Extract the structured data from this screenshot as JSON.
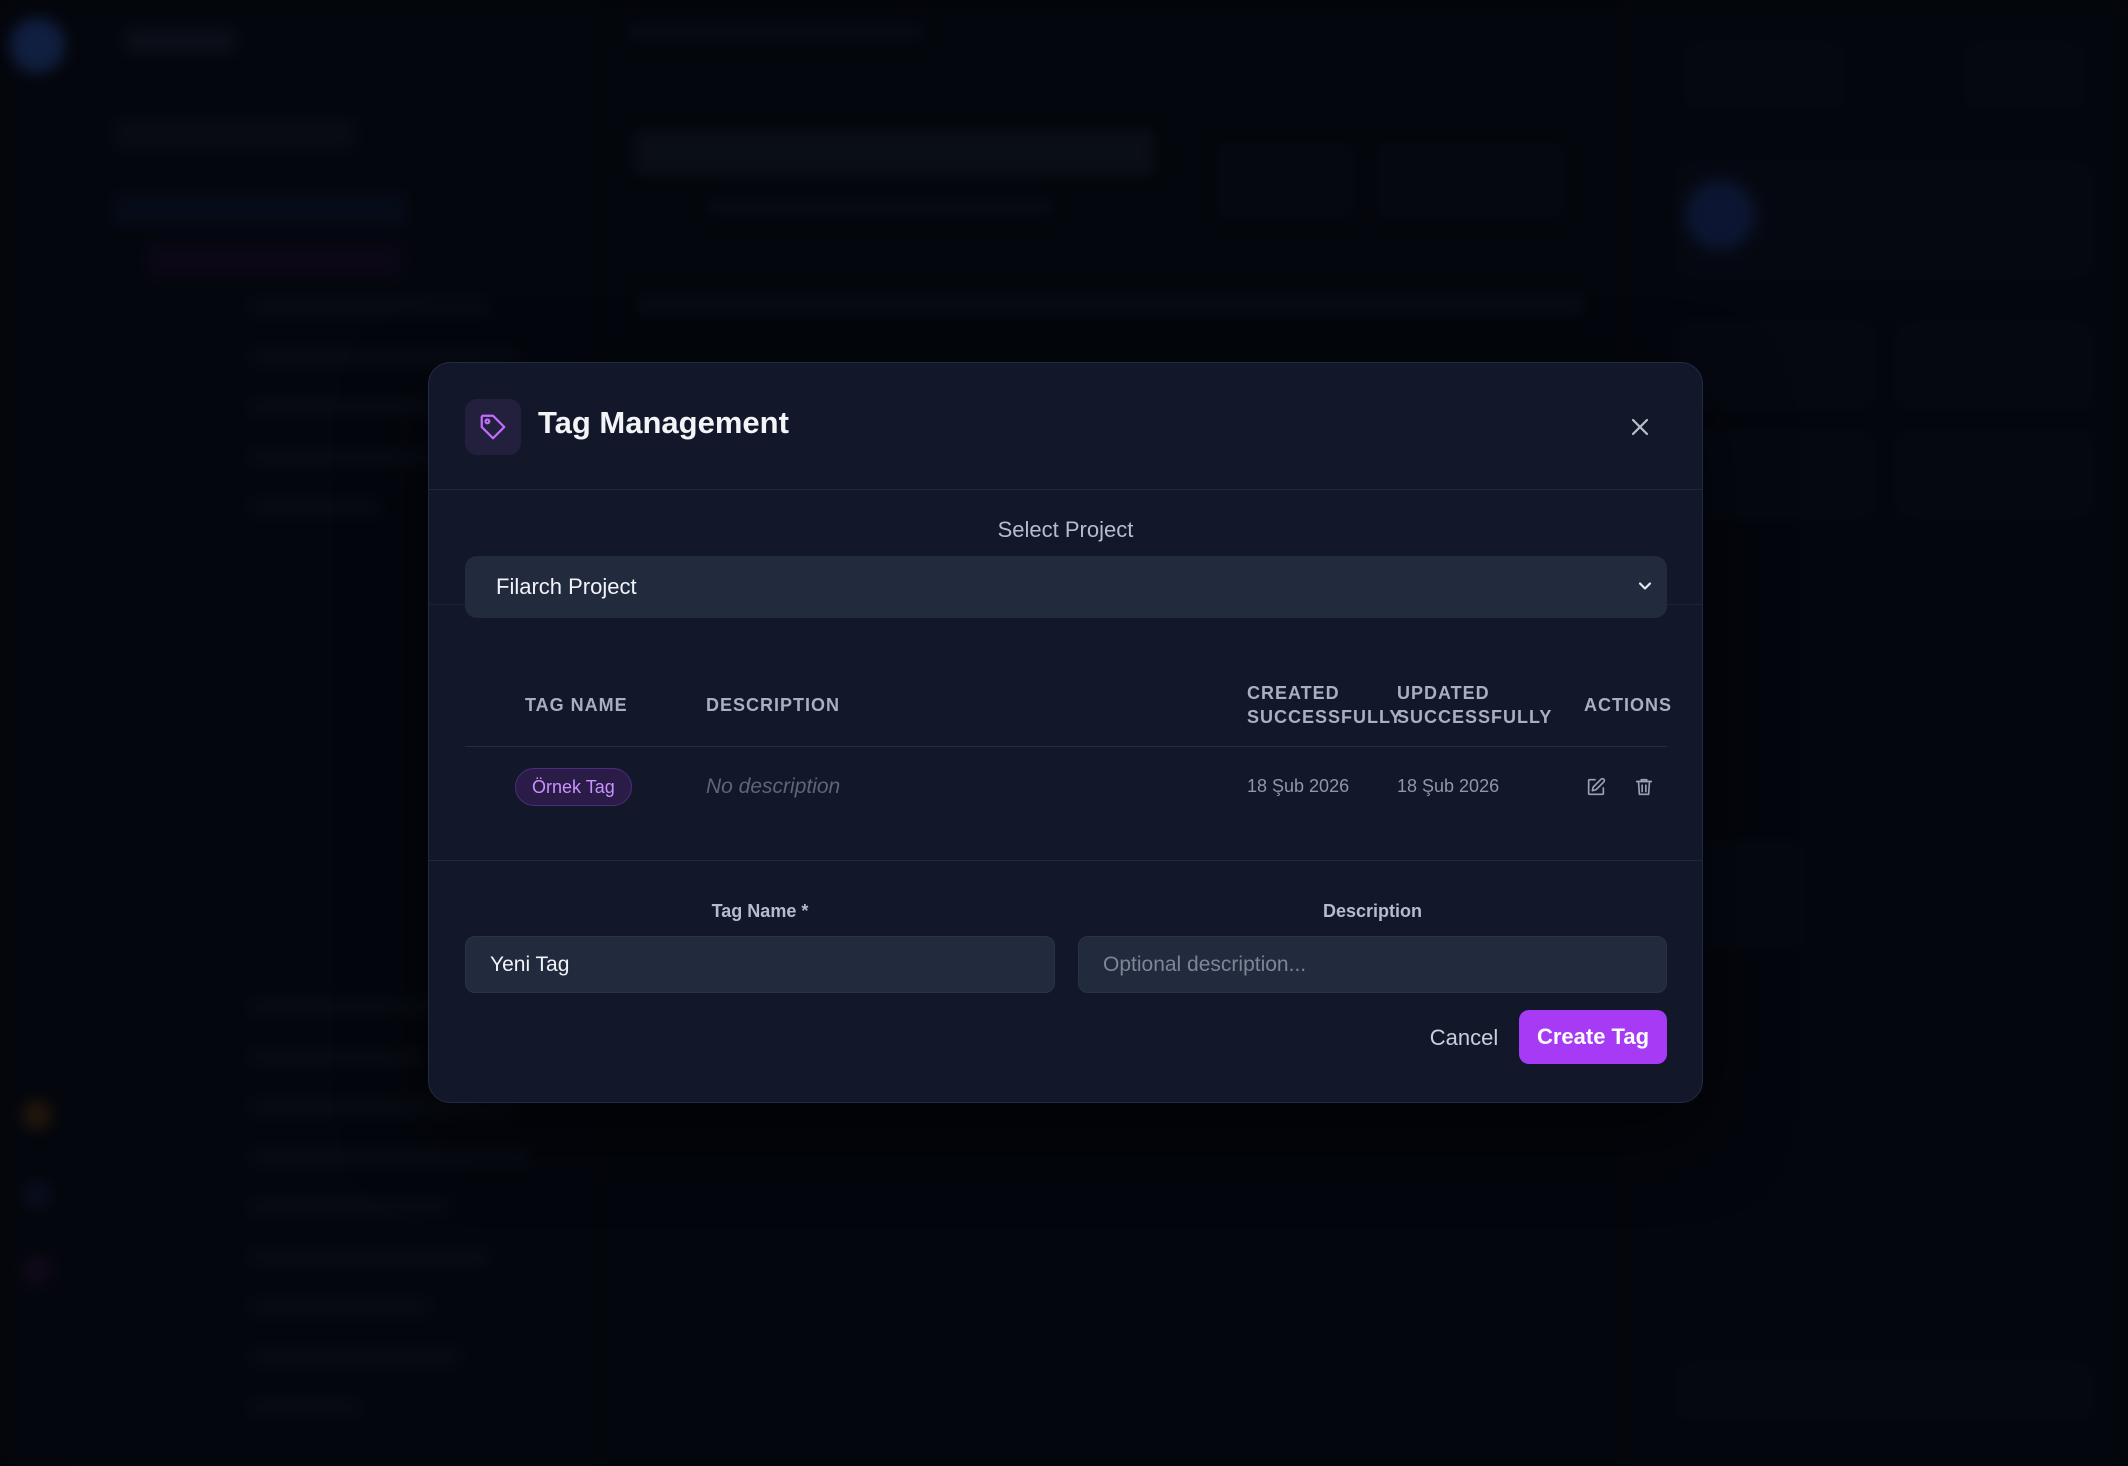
{
  "modal": {
    "title": "Tag Management",
    "icon": "tag-icon",
    "close_icon": "close-icon"
  },
  "project_select": {
    "label": "Select Project",
    "selected": "Filarch Project",
    "icon": "chevron-down-icon"
  },
  "table": {
    "headers": {
      "tag_name": "TAG NAME",
      "description": "DESCRIPTION",
      "created_line1": "CREATED",
      "created_line2": "SUCCESSFULLY",
      "updated_line1": "UPDATED",
      "updated_line2": "SUCCESSFULLY",
      "actions": "ACTIONS"
    },
    "rows": [
      {
        "tag_name": "Örnek Tag",
        "description": "No description",
        "created": "18 Şub 2026",
        "updated": "18 Şub 2026",
        "actions": [
          "edit-icon",
          "trash-icon"
        ]
      }
    ]
  },
  "form": {
    "tag_name_label": "Tag Name *",
    "tag_name_value": "Yeni Tag",
    "description_label": "Description",
    "description_placeholder": "Optional description...",
    "cancel_label": "Cancel",
    "create_label": "Create Tag"
  },
  "colors": {
    "accent": "#a73af5",
    "tag_pill_text": "#c993ff",
    "modal_bg": "#121829"
  }
}
